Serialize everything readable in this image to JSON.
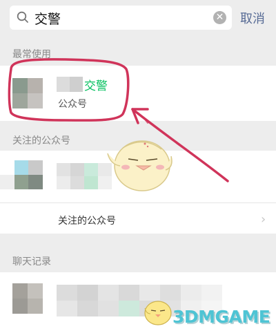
{
  "search": {
    "query": "交警",
    "cancel_label": "取消"
  },
  "sections": {
    "frequent_title": "最常使用",
    "followed_title": "关注的公众号",
    "chat_title": "聊天记录"
  },
  "frequent_result": {
    "name_highlight": "交警",
    "type_label": "公众号"
  },
  "followed_row": {
    "label": "关注的公众号"
  },
  "icons": {
    "search": "search-icon",
    "clear": "clear-icon",
    "chevron": "chevron-right-icon"
  },
  "annotation_color": "#d0345a",
  "watermark": "3DMGAME"
}
